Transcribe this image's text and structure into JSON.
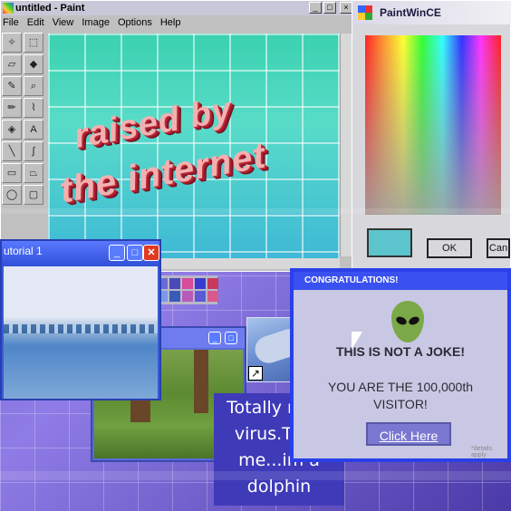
{
  "paint": {
    "title": "untitled - Paint",
    "menu": [
      "File",
      "Edit",
      "View",
      "Image",
      "Options",
      "Help"
    ],
    "canvas_text_line1": "raised by",
    "canvas_text_line2": "the internet",
    "tools": [
      "select-star",
      "select-rect",
      "eraser",
      "fill",
      "picker",
      "zoom",
      "pencil",
      "brush",
      "airbrush",
      "text",
      "line",
      "curve",
      "rectangle",
      "polygon",
      "ellipse",
      "rounded-rect"
    ]
  },
  "paintwince": {
    "title": "PaintWinCE",
    "ok_label": "OK",
    "cancel_label": "Can",
    "selected_color": "#5bc4cc"
  },
  "palette": {
    "colors": [
      "#6a6ad8",
      "#4a4ab8",
      "#d84a9a",
      "#3a3ad0",
      "#c83a5a",
      "#7a9ae8",
      "#3a5ab8",
      "#b85ab8",
      "#5a5ad8",
      "#d85a8a"
    ]
  },
  "tutorial": {
    "title": "utorial 1"
  },
  "dolphin": {
    "caption_line1": "Totally not a",
    "caption_line2": "virus.Trust",
    "caption_line3": "me...im a",
    "caption_line4": "dolphin"
  },
  "congrats": {
    "title": "CONGRATULATIONS!",
    "headline": "THIS IS NOT A JOKE!",
    "message_line1": "YOU ARE THE 100,000th",
    "message_line2": "VISITOR!",
    "button_label": "Click Here",
    "fineprint": "*details apply"
  },
  "colors": {
    "accent_blue": "#2a40e8",
    "slogan_red": "#c02a3a",
    "canvas_teal": "#3ad1b0"
  }
}
